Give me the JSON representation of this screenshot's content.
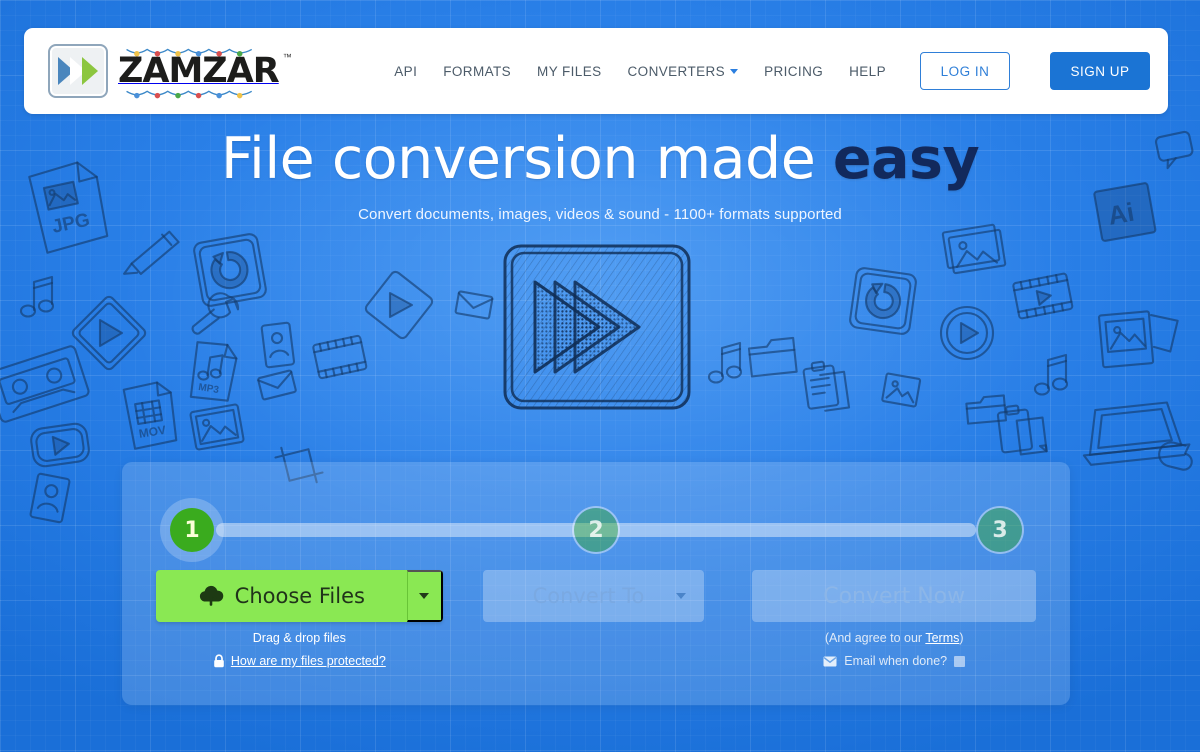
{
  "brand": {
    "name": "ZAMZAR",
    "trademark": "™",
    "logo_icon": "double-chevron-icon",
    "decoration": "string-lights"
  },
  "header": {
    "nav": [
      {
        "label": "API",
        "icon": null
      },
      {
        "label": "FORMATS",
        "icon": null
      },
      {
        "label": "MY FILES",
        "icon": null
      },
      {
        "label": "CONVERTERS",
        "icon": "chevron-down-icon"
      },
      {
        "label": "PRICING",
        "icon": null
      },
      {
        "label": "HELP",
        "icon": null
      }
    ],
    "login_label": "LOG IN",
    "signup_label": "SIGN UP"
  },
  "hero": {
    "title_main": "File conversion made ",
    "title_emphasis": "easy",
    "subtitle": "Convert documents, images, videos & sound - 1100+ formats supported",
    "art_icon": "sketched-play-triangles-icon"
  },
  "converter": {
    "steps": [
      {
        "number": "1",
        "state": "active"
      },
      {
        "number": "2",
        "state": "idle"
      },
      {
        "number": "3",
        "state": "idle"
      }
    ],
    "choose": {
      "label": "Choose Files",
      "icon": "cloud-upload-icon",
      "dropdown_icon": "caret-down-icon",
      "hint": "Drag & drop files",
      "protect_link": "How are my files protected?",
      "protect_icon": "lock-icon"
    },
    "convert_to": {
      "label": "Convert To",
      "dropdown_icon": "caret-down-icon",
      "disabled": "true"
    },
    "convert_now": {
      "label": "Convert Now",
      "disabled": "true",
      "terms_prefix": "(And agree to our ",
      "terms_link": "Terms",
      "terms_suffix": ")",
      "email_label": "Email when done?",
      "email_icon": "envelope-icon",
      "email_checked": "false"
    }
  },
  "colors": {
    "page_blue": "#2079e4",
    "accent_blue": "#1b74d4",
    "green_active": "#3aab1e",
    "green_button": "#8ae853",
    "navy_emphasis": "#12295c",
    "panel_overlay": "rgba(255,255,255,0.17)"
  }
}
